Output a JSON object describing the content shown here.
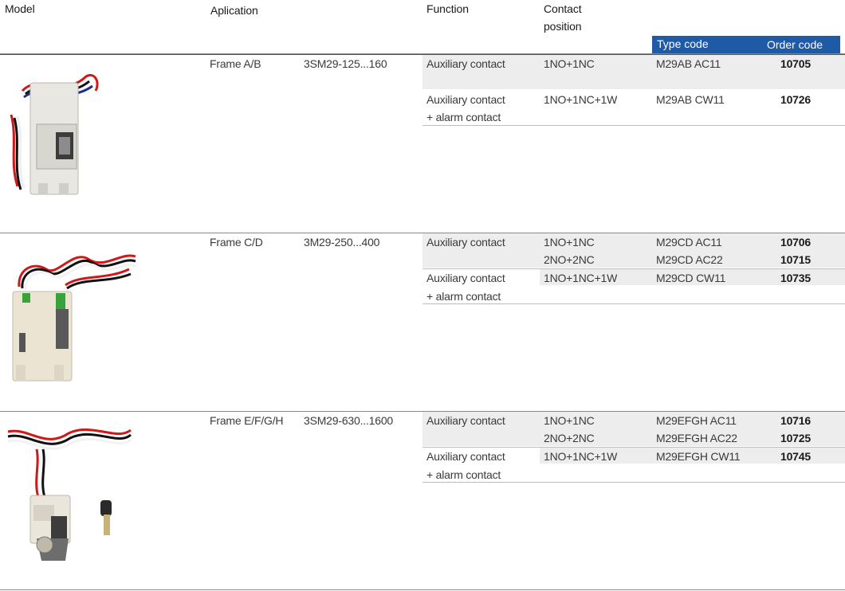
{
  "header": {
    "model": "Model",
    "application": "Aplication",
    "function": "Function",
    "contact_position_1": "Contact",
    "contact_position_2": "position",
    "type_code": "Type code",
    "order_code": "Order code"
  },
  "colors": {
    "header_accent": "#1f5aa6",
    "row_shade": "#ededed"
  },
  "groups": [
    {
      "frame": "Frame A/B",
      "series": "3SM29-125...160",
      "rows": [
        {
          "function_1": "Auxiliary contact",
          "function_2": "",
          "contact": "1NO+1NC",
          "type_code": "M29AB AC11",
          "order_code": "10705"
        },
        {
          "function_1": "Auxiliary contact",
          "function_2": "+ alarm contact",
          "contact": "1NO+1NC+1W",
          "type_code": "M29AB CW11",
          "order_code": "10726"
        }
      ]
    },
    {
      "frame": "Frame C/D",
      "series": "3M29-250...400",
      "rows": [
        {
          "function_1": "Auxiliary contact",
          "function_2": "",
          "contact": "1NO+1NC",
          "type_code": "M29CD AC11",
          "order_code": "10706"
        },
        {
          "function_1": "",
          "function_2": "",
          "contact": "2NO+2NC",
          "type_code": "M29CD AC22",
          "order_code": "10715"
        },
        {
          "function_1": "Auxiliary contact",
          "function_2": "+ alarm contact",
          "contact": "1NO+1NC+1W",
          "type_code": "M29CD CW11",
          "order_code": "10735"
        }
      ]
    },
    {
      "frame": "Frame E/F/G/H",
      "series": "3SM29-630...1600",
      "rows": [
        {
          "function_1": "Auxiliary contact",
          "function_2": "",
          "contact": "1NO+1NC",
          "type_code": "M29EFGH AC11",
          "order_code": "10716"
        },
        {
          "function_1": "",
          "function_2": "",
          "contact": "2NO+2NC",
          "type_code": "M29EFGH AC22",
          "order_code": "10725"
        },
        {
          "function_1": "Auxiliary contact",
          "function_2": "+ alarm contact",
          "contact": "1NO+1NC+1W",
          "type_code": "M29EFGH CW11",
          "order_code": "10745"
        }
      ]
    }
  ]
}
